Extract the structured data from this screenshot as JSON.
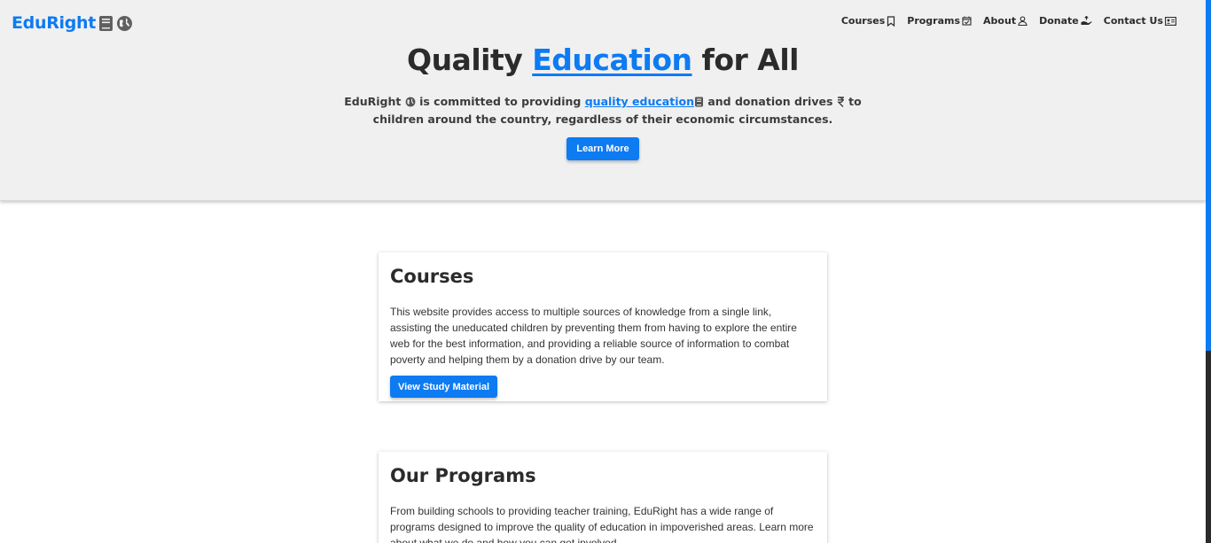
{
  "brand": {
    "name": "EduRight",
    "icons": [
      "book-icon",
      "globe-icon"
    ],
    "color": "#0d7bf2"
  },
  "nav": {
    "items": [
      {
        "label": "Courses",
        "icon": "bookmark-icon"
      },
      {
        "label": "Programs",
        "icon": "calendar-check-icon"
      },
      {
        "label": "About",
        "icon": "person-icon"
      },
      {
        "label": "Donate",
        "icon": "hand-holding-icon"
      },
      {
        "label": "Contact Us",
        "icon": "contact-card-icon"
      }
    ]
  },
  "hero": {
    "title_pre": "Quality",
    "title_highlight": "Education",
    "title_post": "for All",
    "sub_1": "EduRight",
    "sub_2": "is committed to providing",
    "sub_link": "quality education",
    "sub_3": "and donation drives",
    "sub_4": "to",
    "sub_5": "children around the country, regardless of their economic circumstances.",
    "button": "Learn More"
  },
  "cards": [
    {
      "title": "Courses",
      "body": "This website provides access to multiple sources of knowledge from a single link, assisting the uneducated children by preventing them from having to explore the entire web for the best information, and providing a reliable source of information to combat poverty and helping them by a donation drive by our team.",
      "button": "View Study Material"
    },
    {
      "title": "Our Programs",
      "body": "From building schools to providing teacher training, EduRight has a wide range of programs designed to improve the quality of education in impoverished areas. Learn more about what we do and how you can get involved."
    }
  ]
}
